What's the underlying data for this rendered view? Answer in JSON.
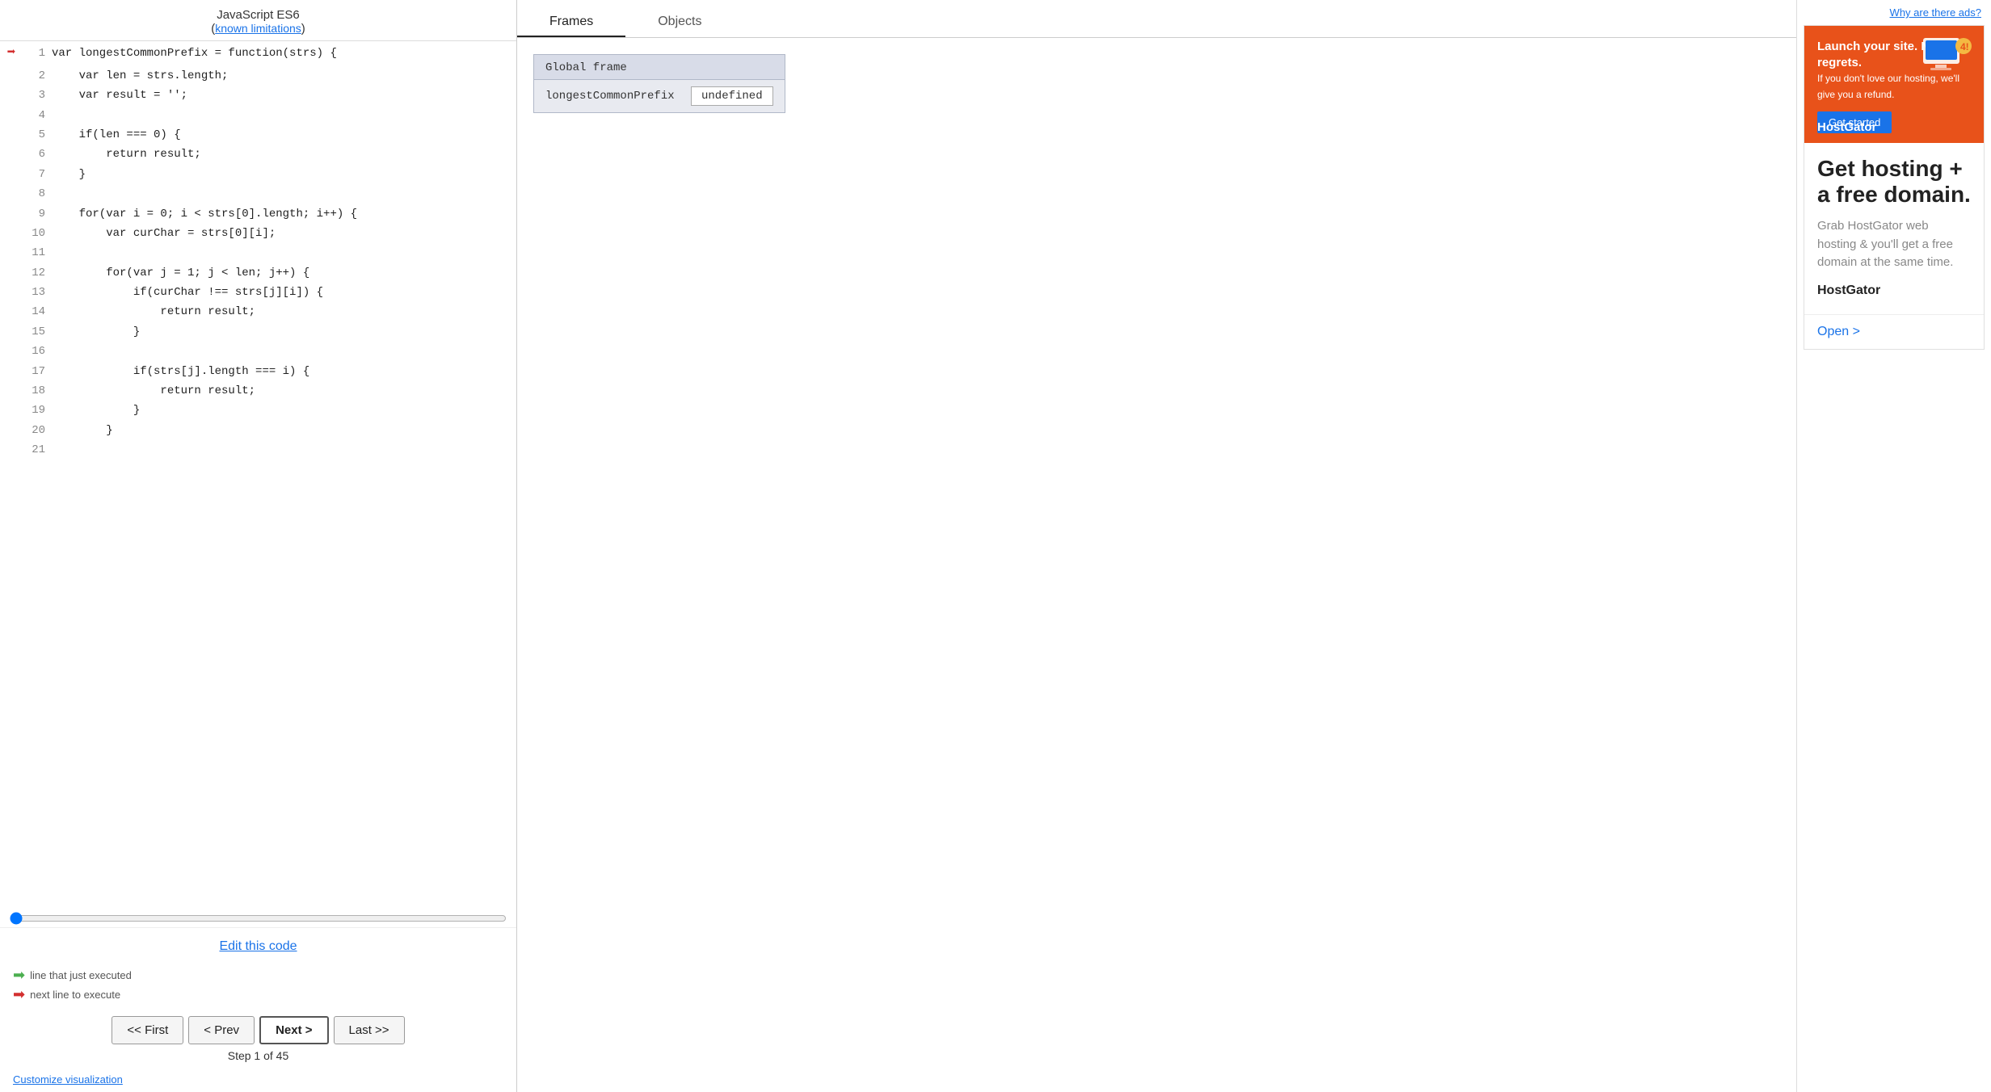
{
  "header": {
    "title": "JavaScript ES6",
    "known_limitations_label": "known limitations"
  },
  "code": {
    "lines": [
      {
        "num": 1,
        "text": "var longestCommonPrefix = function(strs) {",
        "arrow": "red"
      },
      {
        "num": 2,
        "text": "    var len = strs.length;",
        "arrow": ""
      },
      {
        "num": 3,
        "text": "    var result = '';",
        "arrow": ""
      },
      {
        "num": 4,
        "text": "",
        "arrow": ""
      },
      {
        "num": 5,
        "text": "    if(len === 0) {",
        "arrow": ""
      },
      {
        "num": 6,
        "text": "        return result;",
        "arrow": ""
      },
      {
        "num": 7,
        "text": "    }",
        "arrow": ""
      },
      {
        "num": 8,
        "text": "",
        "arrow": ""
      },
      {
        "num": 9,
        "text": "    for(var i = 0; i < strs[0].length; i++) {",
        "arrow": ""
      },
      {
        "num": 10,
        "text": "        var curChar = strs[0][i];",
        "arrow": ""
      },
      {
        "num": 11,
        "text": "",
        "arrow": ""
      },
      {
        "num": 12,
        "text": "        for(var j = 1; j < len; j++) {",
        "arrow": ""
      },
      {
        "num": 13,
        "text": "            if(curChar !== strs[j][i]) {",
        "arrow": ""
      },
      {
        "num": 14,
        "text": "                return result;",
        "arrow": ""
      },
      {
        "num": 15,
        "text": "            }",
        "arrow": ""
      },
      {
        "num": 16,
        "text": "",
        "arrow": ""
      },
      {
        "num": 17,
        "text": "            if(strs[j].length === i) {",
        "arrow": ""
      },
      {
        "num": 18,
        "text": "                return result;",
        "arrow": ""
      },
      {
        "num": 19,
        "text": "            }",
        "arrow": ""
      },
      {
        "num": 20,
        "text": "        }",
        "arrow": ""
      },
      {
        "num": 21,
        "text": "",
        "arrow": ""
      }
    ]
  },
  "edit_link_label": "Edit this code",
  "legend": {
    "green_label": "line that just executed",
    "red_label": "next line to execute"
  },
  "controls": {
    "first_label": "<< First",
    "prev_label": "< Prev",
    "next_label": "Next >",
    "last_label": "Last >>",
    "step_info": "Step 1 of 45"
  },
  "customize_label": "Customize visualization",
  "middle": {
    "frames_tab": "Frames",
    "objects_tab": "Objects",
    "global_frame_label": "Global frame",
    "variables": [
      {
        "name": "longestCommonPrefix",
        "value": "undefined"
      }
    ]
  },
  "ad": {
    "why_ads": "Why are there ads?",
    "banner_title": "Launch your site. No regrets.",
    "banner_subtitle": "If you don't love our hosting, we'll give you a refund.",
    "get_started_label": "Get started",
    "brand": "HostGator",
    "headline": "Get hosting + a free domain.",
    "subtext": "Grab HostGator web hosting & you'll get a free domain at the same time.",
    "open_label": "Open >"
  }
}
